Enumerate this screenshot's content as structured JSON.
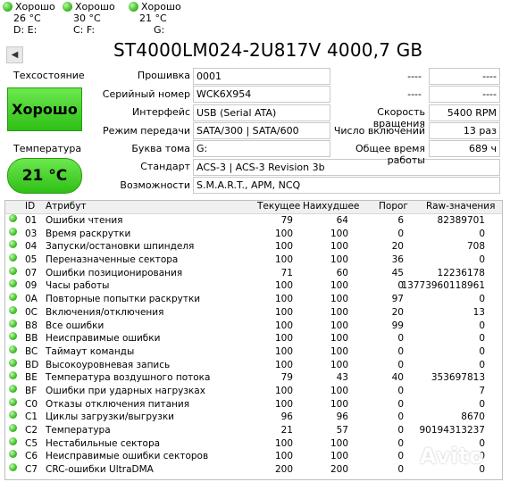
{
  "disks": [
    {
      "status": "Хорошо",
      "temp": "26 °C",
      "letters": "D: E:"
    },
    {
      "status": "Хорошо",
      "temp": "30 °C",
      "letters": "C: F:"
    },
    {
      "status": "Хорошо",
      "temp": "21 °C",
      "letters": "G:"
    }
  ],
  "drive_title": "ST4000LM024-2U817V 4000,7 GB",
  "health": {
    "label": "Техсостояние",
    "value": "Хорошо"
  },
  "temperature": {
    "label": "Температура",
    "value": "21 °C"
  },
  "info": {
    "firmware_label": "Прошивка",
    "firmware": "0001",
    "serial_label": "Серийный номер",
    "serial": "WCK6X954",
    "interface_label": "Интерфейс",
    "interface": "USB (Serial ATA)",
    "transfer_label": "Режим передачи",
    "transfer": "SATA/300 | SATA/600",
    "volume_label": "Буква тома",
    "volume": "G:",
    "standard_label": "Стандарт",
    "standard": "ACS-3 | ACS-3 Revision 3b",
    "features_label": "Возможности",
    "features": "S.M.A.R.T., APM, NCQ",
    "dash1a": "----",
    "dash1b": "----",
    "dash2a": "----",
    "dash2b": "----",
    "rotation_label": "Скорость вращения",
    "rotation": "5400 RPM",
    "power_count_label": "Число включений",
    "power_count": "13 раз",
    "power_hours_label": "Общее время работы",
    "power_hours": "689 ч"
  },
  "table": {
    "headers": {
      "id": "ID",
      "attr": "Атрибут",
      "cur": "Текущее",
      "worst": "Наихудшее",
      "thr": "Порог",
      "raw": "Raw-значения"
    },
    "rows": [
      {
        "id": "01",
        "attr": "Ошибки чтения",
        "cur": "79",
        "worst": "64",
        "thr": "6",
        "raw": "82389701"
      },
      {
        "id": "03",
        "attr": "Время раскрутки",
        "cur": "100",
        "worst": "100",
        "thr": "0",
        "raw": "0"
      },
      {
        "id": "04",
        "attr": "Запуски/остановки шпинделя",
        "cur": "100",
        "worst": "100",
        "thr": "20",
        "raw": "708"
      },
      {
        "id": "05",
        "attr": "Переназначенные сектора",
        "cur": "100",
        "worst": "100",
        "thr": "36",
        "raw": "0"
      },
      {
        "id": "07",
        "attr": "Ошибки позиционирования",
        "cur": "71",
        "worst": "60",
        "thr": "45",
        "raw": "12236178"
      },
      {
        "id": "09",
        "attr": "Часы работы",
        "cur": "100",
        "worst": "100",
        "thr": "0",
        "raw": "13773960118961"
      },
      {
        "id": "0A",
        "attr": "Повторные попытки раскрутки",
        "cur": "100",
        "worst": "100",
        "thr": "97",
        "raw": "0"
      },
      {
        "id": "0C",
        "attr": "Включения/отключения",
        "cur": "100",
        "worst": "100",
        "thr": "20",
        "raw": "13"
      },
      {
        "id": "B8",
        "attr": "Все ошибки",
        "cur": "100",
        "worst": "100",
        "thr": "99",
        "raw": "0"
      },
      {
        "id": "BB",
        "attr": "Неисправимые ошибки",
        "cur": "100",
        "worst": "100",
        "thr": "0",
        "raw": "0"
      },
      {
        "id": "BC",
        "attr": "Таймаут команды",
        "cur": "100",
        "worst": "100",
        "thr": "0",
        "raw": "0"
      },
      {
        "id": "BD",
        "attr": "Высокоуровневая запись",
        "cur": "100",
        "worst": "100",
        "thr": "0",
        "raw": "0"
      },
      {
        "id": "BE",
        "attr": "Температура воздушного потока",
        "cur": "79",
        "worst": "43",
        "thr": "40",
        "raw": "353697813"
      },
      {
        "id": "BF",
        "attr": "Ошибки при ударных нагрузках",
        "cur": "100",
        "worst": "100",
        "thr": "0",
        "raw": "7"
      },
      {
        "id": "C0",
        "attr": "Отказы отключения питания",
        "cur": "100",
        "worst": "100",
        "thr": "0",
        "raw": "0"
      },
      {
        "id": "C1",
        "attr": "Циклы загрузки/выгрузки",
        "cur": "96",
        "worst": "96",
        "thr": "0",
        "raw": "8670"
      },
      {
        "id": "C2",
        "attr": "Температура",
        "cur": "21",
        "worst": "57",
        "thr": "0",
        "raw": "90194313237"
      },
      {
        "id": "C5",
        "attr": "Нестабильные сектора",
        "cur": "100",
        "worst": "100",
        "thr": "0",
        "raw": "0"
      },
      {
        "id": "C6",
        "attr": "Неисправимые ошибки секторов",
        "cur": "100",
        "worst": "100",
        "thr": "0",
        "raw": "0"
      },
      {
        "id": "C7",
        "attr": "CRC-ошибки UltraDMA",
        "cur": "200",
        "worst": "200",
        "thr": "0",
        "raw": "0"
      }
    ]
  },
  "watermark": "Avito"
}
